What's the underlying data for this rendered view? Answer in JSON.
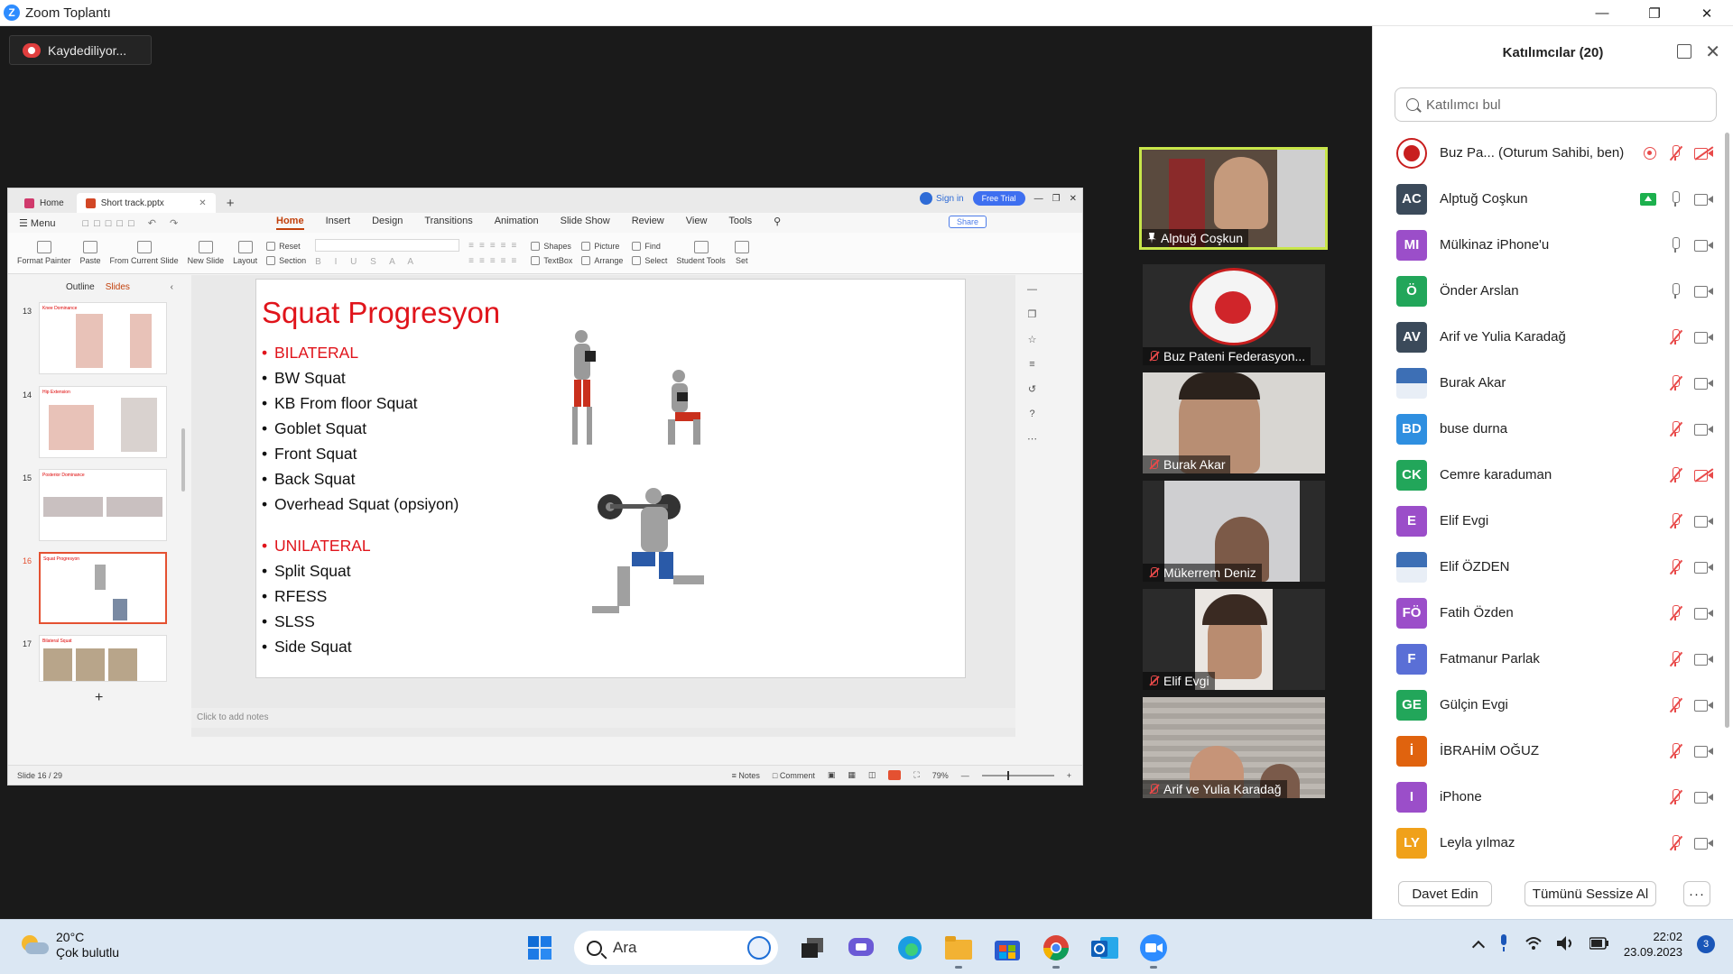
{
  "window": {
    "title": "Zoom Toplantı",
    "logo_letter": "Z"
  },
  "recording": {
    "label": "Kaydediliyor..."
  },
  "wps": {
    "tabs": [
      {
        "label": "Home"
      },
      {
        "label": "Short track.pptx"
      }
    ],
    "sign_in": "Sign in",
    "free_trial": "Free Trial",
    "menu_label": "Menu",
    "menu_tabs": [
      "Home",
      "Insert",
      "Design",
      "Transitions",
      "Animation",
      "Slide Show",
      "Review",
      "View",
      "Tools"
    ],
    "share": "Share",
    "ribbon": {
      "format_painter": "Format Painter",
      "paste": "Paste",
      "from_current_slide": "From Current Slide",
      "new_slide": "New Slide",
      "layout": "Layout",
      "reset": "Reset",
      "section": "Section",
      "shapes": "Shapes",
      "picture": "Picture",
      "textbox": "TextBox",
      "arrange": "Arrange",
      "find": "Find",
      "select": "Select",
      "student_tools": "Student Tools",
      "set": "Set"
    },
    "pane_tabs": {
      "outline": "Outline",
      "slides": "Slides"
    },
    "thumbnails": [
      {
        "num": "13",
        "title": "Knee Dominance"
      },
      {
        "num": "14",
        "title": "Hip Extension"
      },
      {
        "num": "15",
        "title": "Posterior Dominance"
      },
      {
        "num": "16",
        "title": "Squat Progresyon"
      },
      {
        "num": "17",
        "title": "Bilateral Squat"
      }
    ],
    "slide": {
      "title": "Squat Progresyon",
      "items": [
        {
          "text": "BILATERAL",
          "heading": true
        },
        {
          "text": "BW Squat"
        },
        {
          "text": "KB From floor Squat"
        },
        {
          "text": "Goblet Squat"
        },
        {
          "text": "Front Squat"
        },
        {
          "text": "Back Squat"
        },
        {
          "text": "Overhead Squat (opsiyon)"
        },
        {
          "text": "",
          "spacer": true
        },
        {
          "text": "UNILATERAL",
          "heading": true
        },
        {
          "text": "Split Squat"
        },
        {
          "text": "RFESS"
        },
        {
          "text": "SLSS"
        },
        {
          "text": "Side Squat"
        }
      ]
    },
    "notes_placeholder": "Click to add notes",
    "status": {
      "slide_counter": "Slide 16 / 29",
      "notes": "Notes",
      "comment": "Comment",
      "zoom": "79%"
    }
  },
  "video_tiles": [
    {
      "name": "Alptuğ Coşkun",
      "active": true,
      "pinned": true
    },
    {
      "name": "Buz Pateni Federasyon...",
      "muted": true
    },
    {
      "name": "Burak Akar",
      "muted": true
    },
    {
      "name": "Mükerrem Deniz",
      "muted": true
    },
    {
      "name": "Elif Evgi",
      "muted": true
    },
    {
      "name": "Arif ve Yulia Karadağ",
      "muted": true
    }
  ],
  "participants": {
    "title": "Katılımcılar (20)",
    "search_placeholder": "Katılımcı bul",
    "list": [
      {
        "initials": "",
        "name": "Buz Pa... (Oturum Sahibi, ben)",
        "color": "#ffffff",
        "mic": "off",
        "cam": "off",
        "rec": true
      },
      {
        "initials": "AC",
        "name": "Alptuğ Coşkun",
        "color": "#3b4a5a",
        "mic": "on",
        "cam": "on",
        "share": true
      },
      {
        "initials": "MI",
        "name": "Mülkinaz iPhone'u",
        "color": "#9b4ec9",
        "mic": "on",
        "cam": "on"
      },
      {
        "initials": "Ö",
        "name": "Önder Arslan",
        "color": "#22a65a",
        "mic": "on",
        "cam": "on"
      },
      {
        "initials": "AV",
        "name": "Arif ve Yulia Karadağ",
        "color": "#3b4a5a",
        "mic": "off",
        "cam": "on"
      },
      {
        "initials": "",
        "name": "Burak Akar",
        "color": "#2a4e8c",
        "mic": "off",
        "cam": "on"
      },
      {
        "initials": "BD",
        "name": "buse durna",
        "color": "#2f8fe0",
        "mic": "off",
        "cam": "on"
      },
      {
        "initials": "CK",
        "name": "Cemre karaduman",
        "color": "#22a65a",
        "mic": "off",
        "cam": "off"
      },
      {
        "initials": "E",
        "name": "Elif Evgi",
        "color": "#9b4ec9",
        "mic": "off",
        "cam": "on"
      },
      {
        "initials": "",
        "name": "Elif ÖZDEN",
        "color": "#3a5f8a",
        "mic": "off",
        "cam": "on"
      },
      {
        "initials": "FÖ",
        "name": "Fatih Özden",
        "color": "#9b4ec9",
        "mic": "off",
        "cam": "on"
      },
      {
        "initials": "F",
        "name": "Fatmanur Parlak",
        "color": "#5a6fd6",
        "mic": "off",
        "cam": "on"
      },
      {
        "initials": "GE",
        "name": "Gülçin Evgi",
        "color": "#22a65a",
        "mic": "off",
        "cam": "on"
      },
      {
        "initials": "İ",
        "name": "İBRAHİM OĞUZ",
        "color": "#e0630e",
        "mic": "off",
        "cam": "on"
      },
      {
        "initials": "I",
        "name": "iPhone",
        "color": "#9b4ec9",
        "mic": "off",
        "cam": "on"
      },
      {
        "initials": "LY",
        "name": "Leyla yılmaz",
        "color": "#f0a11a",
        "mic": "off",
        "cam": "on"
      }
    ],
    "invite": "Davet Edin",
    "mute_all": "Tümünü Sessize Al",
    "more": "···"
  },
  "taskbar": {
    "temp": "20°C",
    "weather": "Çok bulutlu",
    "search": "Ara",
    "time": "22:02",
    "date": "23.09.2023",
    "notifications": "3"
  }
}
